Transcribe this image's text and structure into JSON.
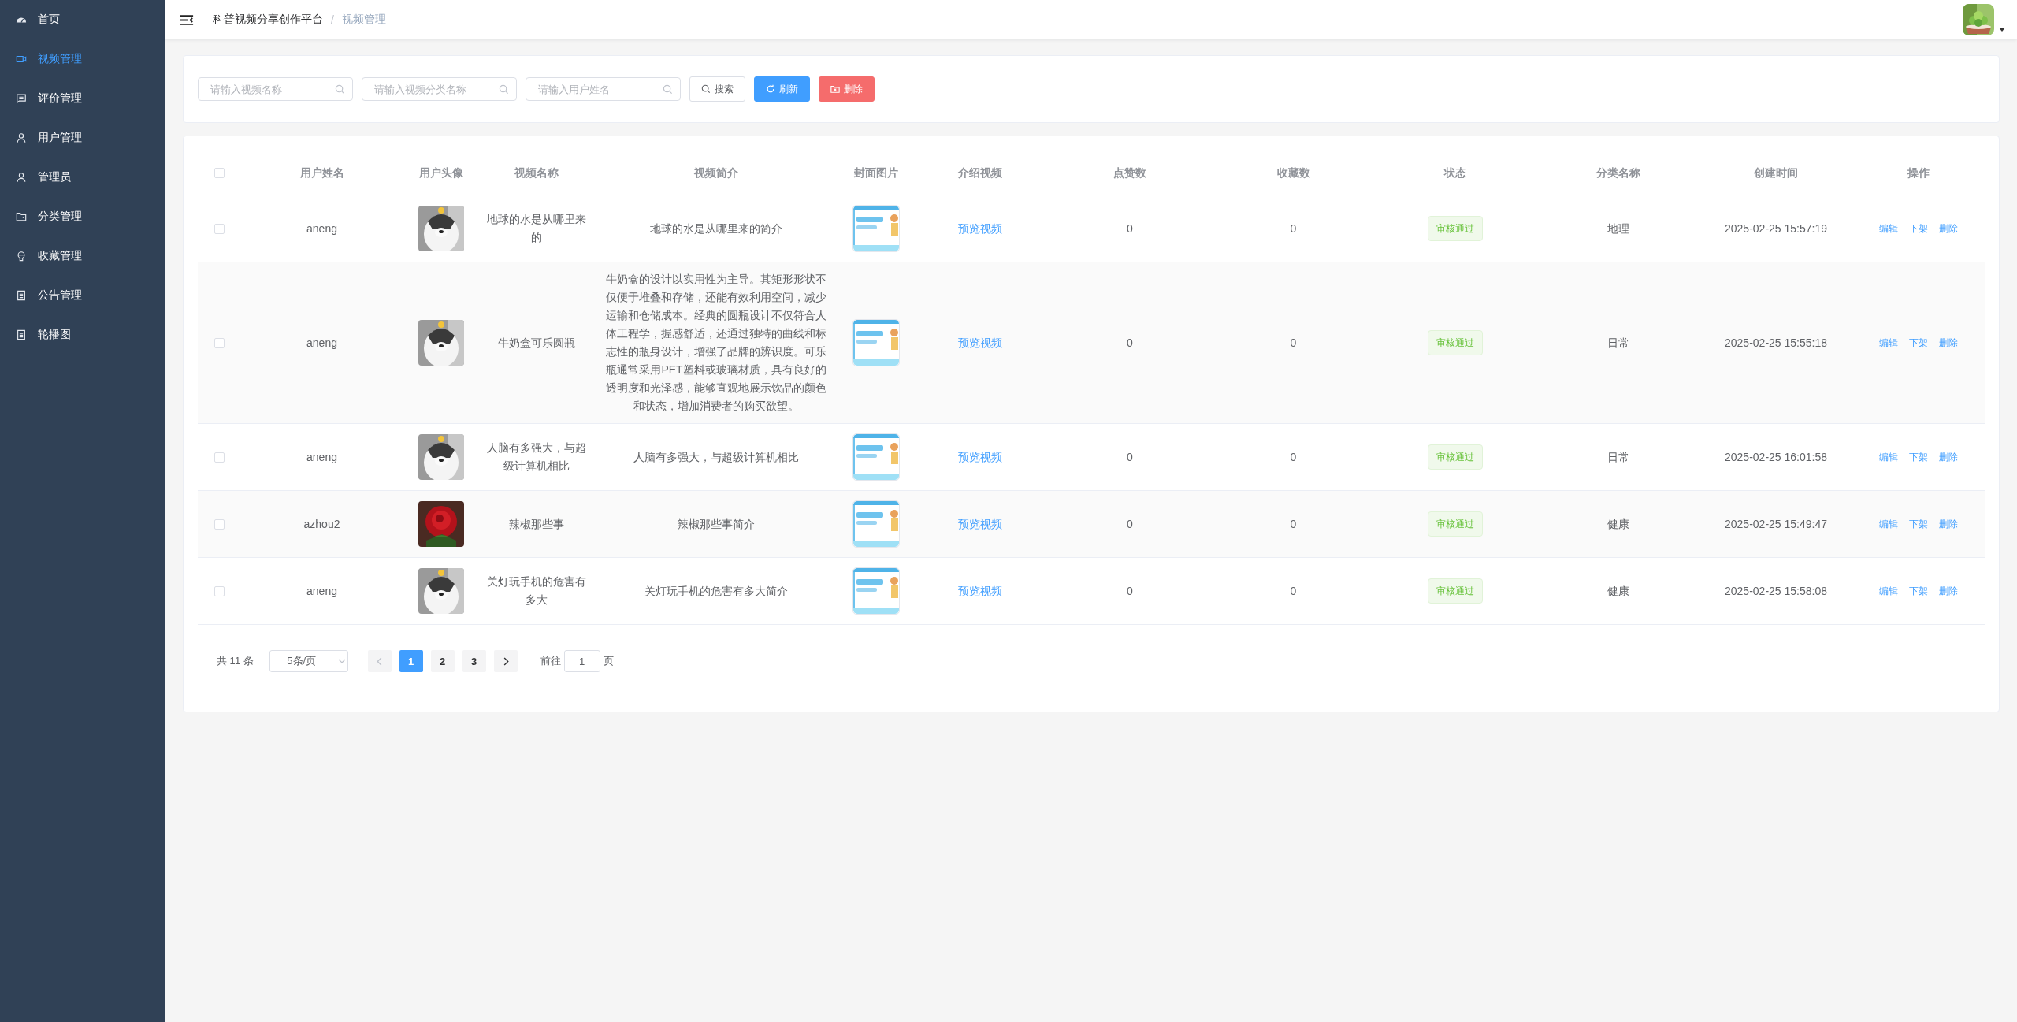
{
  "sidebar": {
    "items": [
      {
        "label": "首页",
        "kind": "gauge",
        "selected": false
      },
      {
        "label": "视频管理",
        "kind": "video",
        "selected": true
      },
      {
        "label": "评价管理",
        "kind": "comment",
        "selected": false
      },
      {
        "label": "用户管理",
        "kind": "user",
        "selected": false
      },
      {
        "label": "管理员",
        "kind": "user",
        "selected": false
      },
      {
        "label": "分类管理",
        "kind": "folder",
        "selected": false
      },
      {
        "label": "收藏管理",
        "kind": "bulb",
        "selected": false
      },
      {
        "label": "公告管理",
        "kind": "doc",
        "selected": false
      },
      {
        "label": "轮播图",
        "kind": "doc",
        "selected": false
      }
    ]
  },
  "breadcrumb": {
    "separator": "/",
    "items": [
      "科普视频分享创作平台",
      "视频管理"
    ]
  },
  "search": {
    "fields": [
      {
        "placeholder": "请输入视频名称"
      },
      {
        "placeholder": "请输入视频分类名称"
      },
      {
        "placeholder": "请输入用户姓名"
      }
    ],
    "buttons": [
      {
        "label": "搜索",
        "kind": "plain"
      },
      {
        "label": "刷新",
        "kind": "primary"
      },
      {
        "label": "删除",
        "kind": "danger"
      }
    ]
  },
  "table": {
    "select_all": {
      "checked": false
    },
    "columns": [
      "用户姓名",
      "用户头像",
      "视频名称",
      "视频简介",
      "封面图片",
      "介绍视频",
      "点赞数",
      "收藏数",
      "状态",
      "分类名称",
      "创建时间",
      "操作"
    ],
    "rows": [
      {
        "checked": false,
        "user": "aneng",
        "name": "地球的水是从哪里来的",
        "intro": "地球的水是从哪里来的简介",
        "video": "预览视频",
        "likes": "0",
        "favorites": "0",
        "status": "审核通过",
        "category": "地理",
        "created": "2025-02-25 15:57:19",
        "actions": [
          "编辑",
          "下架",
          "删除"
        ]
      },
      {
        "checked": false,
        "user": "aneng",
        "name": "牛奶盒可乐圆瓶",
        "intro": "牛奶盒的设计以实用性为主导。其矩形形状不仅便于堆叠和存储，还能有效利用空间，减少运输和仓储成本。经典的圆瓶设计不仅符合人体工程学，握感舒适，还通过独特的曲线和标志性的瓶身设计，增强了品牌的辨识度。可乐瓶通常采用PET塑料或玻璃材质，具有良好的透明度和光泽感，能够直观地展示饮品的颜色和状态，增加消费者的购买欲望。",
        "video": "预览视频",
        "likes": "0",
        "favorites": "0",
        "status": "审核通过",
        "category": "日常",
        "created": "2025-02-25 15:55:18",
        "actions": [
          "编辑",
          "下架",
          "删除"
        ]
      },
      {
        "checked": false,
        "user": "aneng",
        "name": "人脑有多强大，与超级计算机相比",
        "intro": "人脑有多强大，与超级计算机相比",
        "video": "预览视频",
        "likes": "0",
        "favorites": "0",
        "status": "审核通过",
        "category": "日常",
        "created": "2025-02-25 16:01:58",
        "actions": [
          "编辑",
          "下架",
          "删除"
        ]
      },
      {
        "checked": false,
        "user": "azhou2",
        "name": "辣椒那些事",
        "intro": "辣椒那些事简介",
        "video": "预览视频",
        "likes": "0",
        "favorites": "0",
        "status": "审核通过",
        "category": "健康",
        "created": "2025-02-25 15:49:47",
        "actions": [
          "编辑",
          "下架",
          "删除"
        ]
      },
      {
        "checked": false,
        "user": "aneng",
        "name": "关灯玩手机的危害有多大",
        "intro": "关灯玩手机的危害有多大简介",
        "video": "预览视频",
        "likes": "0",
        "favorites": "0",
        "status": "审核通过",
        "category": "健康",
        "created": "2025-02-25 15:58:08",
        "actions": [
          "编辑",
          "下架",
          "删除"
        ]
      }
    ]
  },
  "pagination": {
    "total": "共 11 条",
    "page_size": "5条/页",
    "prev": {
      "disabled": true
    },
    "pages": [
      {
        "label": "1",
        "selected": true
      },
      {
        "label": "2",
        "selected": false
      },
      {
        "label": "3",
        "selected": false
      }
    ],
    "next": {
      "disabled": false
    },
    "goto_label": "前往",
    "goto_value": "1",
    "goto_suffix": "页"
  }
}
